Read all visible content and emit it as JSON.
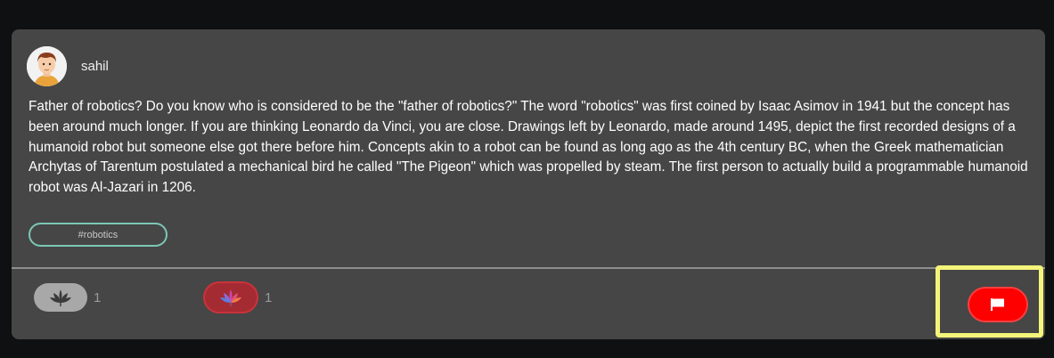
{
  "post": {
    "author": "sahil",
    "text": "Father of robotics? Do you know who is considered to be the \"father of robotics?\" The word \"robotics\" was first coined by Isaac Asimov in 1941 but the concept has been around much longer. If you are thinking Leonardo da Vinci, you are close. Drawings left by Leonardo, made around 1495, depict the first recorded designs of a humanoid robot but someone else got there before him. Concepts akin to a robot can be found as long ago as the 4th century BC, when the Greek mathematician Archytas of Tarentum postulated a mechanical bird he called \"The Pigeon\" which was propelled by steam. The first person to actually build a programmable humanoid robot was Al-Jazari in 1206.",
    "tag": "#robotics"
  },
  "reactions": [
    {
      "icon": "lotus-icon",
      "count": "1",
      "color": "#a8a8a8"
    },
    {
      "icon": "lotus-icon",
      "count": "1",
      "color": "#a52b32"
    }
  ],
  "flag": {
    "icon": "flag-icon",
    "color": "#ff0000"
  },
  "highlight_color": "#f4f47a"
}
